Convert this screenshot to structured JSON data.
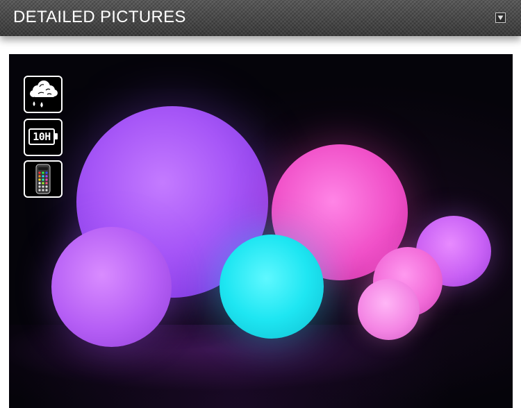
{
  "header": {
    "title": "DETAILED PICTURES",
    "toggle_icon": "triangle-down-icon"
  },
  "photo": {
    "features": [
      {
        "icon": "rain-cloud-icon",
        "label": ""
      },
      {
        "icon": "battery-icon",
        "label": "10H"
      },
      {
        "icon": "remote-control-icon",
        "label": ""
      }
    ]
  },
  "colors": {
    "header_bg": "#3f3f3f",
    "photo_bg": "#05040a",
    "orb_violet": "#a656f7",
    "orb_pink": "#f050c8",
    "orb_cyan": "#1ee6f2"
  }
}
